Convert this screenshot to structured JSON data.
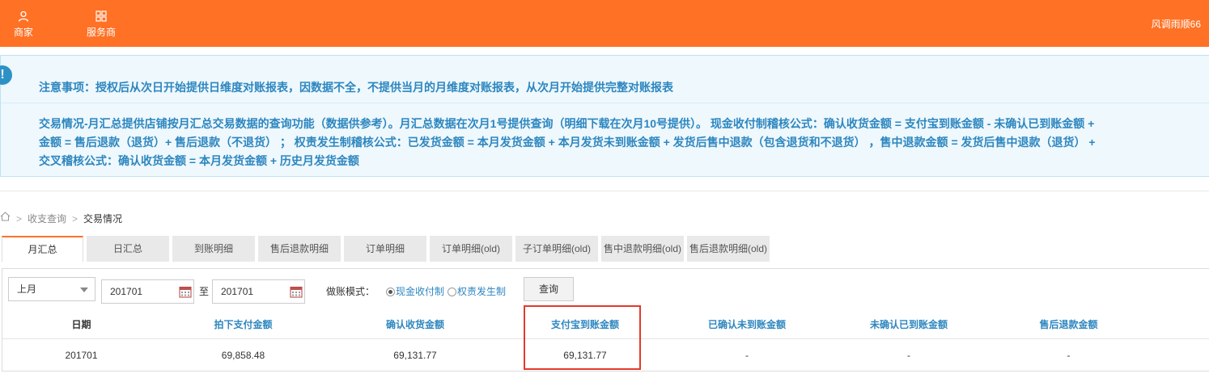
{
  "header": {
    "nav": [
      {
        "label": "商家",
        "icon": "user-icon"
      },
      {
        "label": "服务商",
        "icon": "apps-grid-icon"
      }
    ],
    "username": "风调雨顺66",
    "color": "#ff7125"
  },
  "notice": {
    "title": "注意事项：授权后从次日开始提供日维度对账报表，因数据不全，不提供当月的月维度对账报表，从次月开始提供完整对账报表",
    "lines": [
      "交易情况-月汇总提供店铺按月汇总交易数据的查询功能（数据供参考）。月汇总数据在次月1号提供查询（明细下载在次月10号提供）。 现金收付制稽核公式：确认收货金额 = 支付宝到账金额 - 未确认已到账金额 +",
      "金额 = 售后退款（退货）+ 售后退款（不退货） ； 权责发生制稽核公式：已发货金额 = 本月发货金额 + 本月发货未到账金额 + 发货后售中退款（包含退货和不退货） ，售中退款金额 = 发货后售中退款（退货） +",
      "交叉稽核公式：确认收货金额 = 本月发货金额 + 历史月发货金额"
    ]
  },
  "breadcrumb": {
    "items": [
      "收支查询",
      "交易情况"
    ]
  },
  "tabs": [
    {
      "label": "月汇总",
      "active": true
    },
    {
      "label": "日汇总"
    },
    {
      "label": "到账明细"
    },
    {
      "label": "售后退款明细"
    },
    {
      "label": "订单明细"
    },
    {
      "label": "订单明细(old)"
    },
    {
      "label": "子订单明细(old)"
    },
    {
      "label": "售中退款明细(old)"
    },
    {
      "label": "售后退款明细(old)"
    }
  ],
  "filter": {
    "period": "上月",
    "start_date": "201701",
    "to_label": "至",
    "end_date": "201701",
    "mode_label": "做账模式：",
    "mode_options": [
      "现金收付制",
      "权责发生制"
    ],
    "mode_selected": "现金收付制",
    "query_label": "查询"
  },
  "table": {
    "headers": [
      "日期",
      "拍下支付金额",
      "确认收货金额",
      "支付宝到账金额",
      "已确认未到账金额",
      "未确认已到账金额",
      "售后退款金额"
    ],
    "rows": [
      [
        "201701",
        "69,858.48",
        "69,131.77",
        "69,131.77",
        "-",
        "-",
        "-"
      ]
    ],
    "highlighted_column": "支付宝到账金额",
    "highlight_color": "#e23a2b"
  }
}
